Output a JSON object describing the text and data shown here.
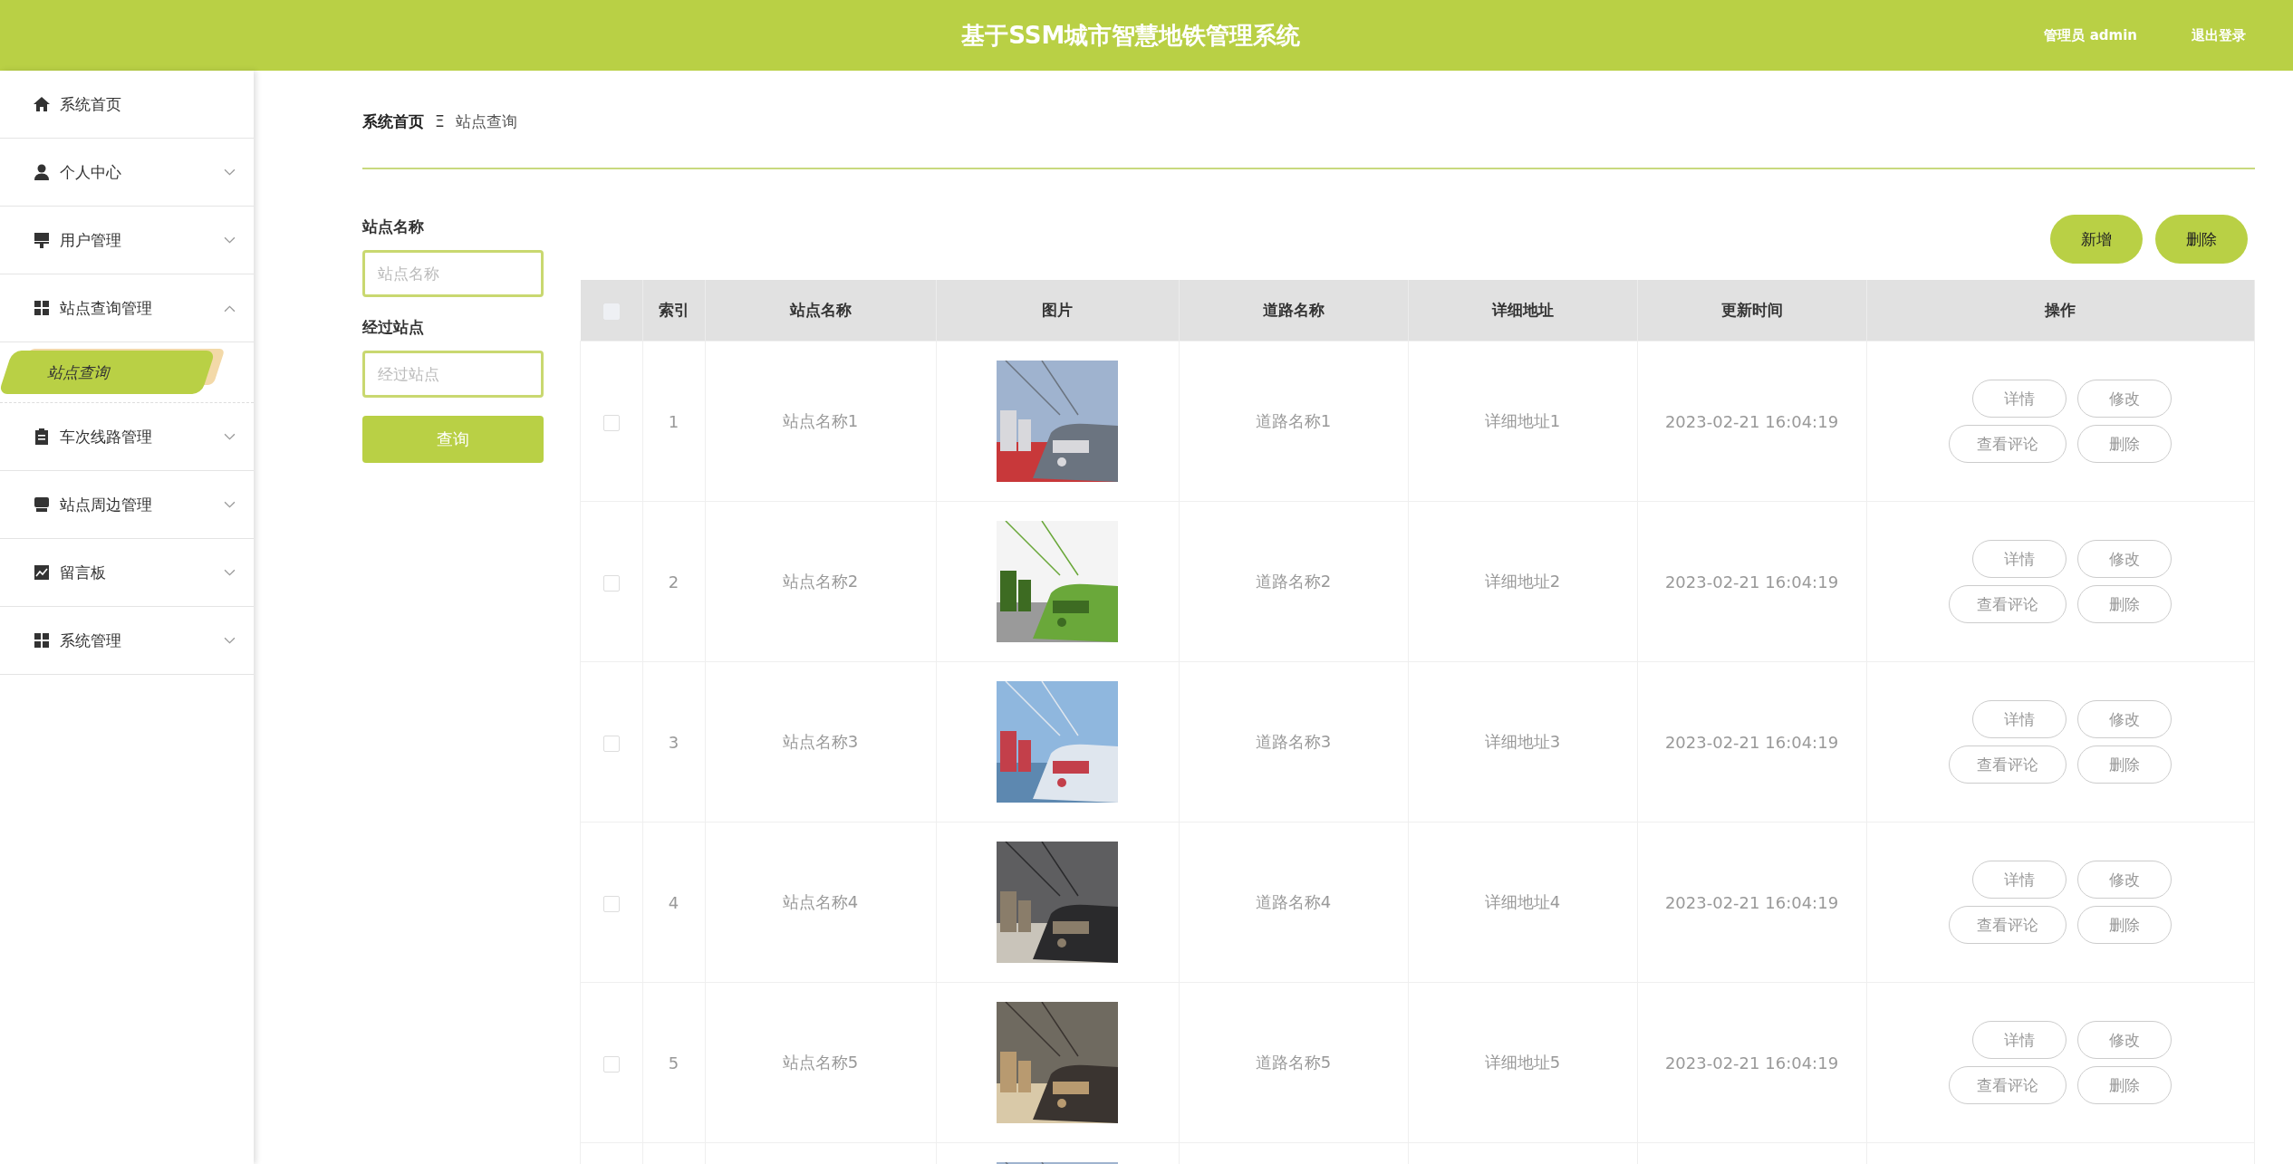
{
  "header": {
    "title": "基于SSM城市智慧地铁管理系统",
    "user": "管理员 admin",
    "logout": "退出登录"
  },
  "sidebar": {
    "items": [
      {
        "kind": "link",
        "label": "系统首页"
      },
      {
        "kind": "menu",
        "label": "个人中心",
        "expanded": false
      },
      {
        "kind": "menu",
        "label": "用户管理",
        "expanded": false
      },
      {
        "kind": "menu",
        "label": "站点查询管理",
        "expanded": true,
        "children": [
          {
            "label": "站点查询",
            "selected": true
          }
        ]
      },
      {
        "kind": "menu",
        "label": "车次线路管理",
        "expanded": false
      },
      {
        "kind": "menu",
        "label": "站点周边管理",
        "expanded": false
      },
      {
        "kind": "menu",
        "label": "留言板",
        "expanded": false
      },
      {
        "kind": "menu",
        "label": "系统管理",
        "expanded": false
      }
    ]
  },
  "breadcrumb": {
    "home": "系统首页",
    "separator": "Ξ",
    "current": "站点查询"
  },
  "filters": [
    {
      "label": "站点名称",
      "placeholder": "站点名称"
    },
    {
      "label": "经过站点",
      "placeholder": "经过站点"
    }
  ],
  "search_button": "查询",
  "toolbar": [
    "新增",
    "删除"
  ],
  "table": {
    "select_all": {
      "checked": false
    },
    "columns": [
      "索引",
      "站点名称",
      "图片",
      "道路名称",
      "详细地址",
      "更新时间",
      "操作"
    ],
    "rows": [
      {
        "checked": false,
        "index": "1",
        "name": "站点名称1",
        "picture": {
          "kind": "picture"
        },
        "road": "道路名称1",
        "address": "详细地址1",
        "time": "2023-02-21 16:04:19",
        "actions": [
          "详情",
          "修改",
          "查看评论",
          "删除"
        ]
      },
      {
        "checked": false,
        "index": "2",
        "name": "站点名称2",
        "picture": {
          "kind": "picture"
        },
        "road": "道路名称2",
        "address": "详细地址2",
        "time": "2023-02-21 16:04:19",
        "actions": [
          "详情",
          "修改",
          "查看评论",
          "删除"
        ]
      },
      {
        "checked": false,
        "index": "3",
        "name": "站点名称3",
        "picture": {
          "kind": "picture"
        },
        "road": "道路名称3",
        "address": "详细地址3",
        "time": "2023-02-21 16:04:19",
        "actions": [
          "详情",
          "修改",
          "查看评论",
          "删除"
        ]
      },
      {
        "checked": false,
        "index": "4",
        "name": "站点名称4",
        "picture": {
          "kind": "picture"
        },
        "road": "道路名称4",
        "address": "详细地址4",
        "time": "2023-02-21 16:04:19",
        "actions": [
          "详情",
          "修改",
          "查看评论",
          "删除"
        ]
      },
      {
        "checked": false,
        "index": "5",
        "name": "站点名称5",
        "picture": {
          "kind": "picture"
        },
        "road": "道路名称5",
        "address": "详细地址5",
        "time": "2023-02-21 16:04:19",
        "actions": [
          "详情",
          "修改",
          "查看评论",
          "删除"
        ]
      },
      {
        "picture": {
          "kind": "picture"
        }
      }
    ]
  }
}
